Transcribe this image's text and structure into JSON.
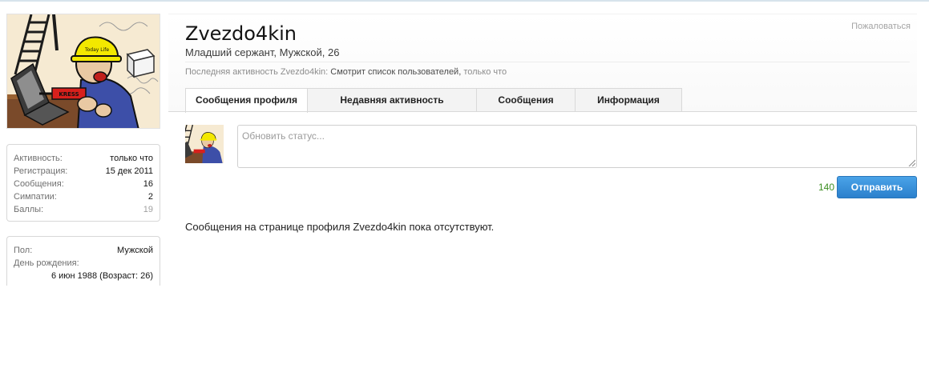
{
  "profile": {
    "username": "Zvezdo4kin",
    "subtitle": "Младший сержант, Мужской, 26",
    "report_label": "Пожаловаться",
    "last_activity": {
      "prefix": "Последняя активность Zvezdo4kin:",
      "action": "Смотрит список пользователей,",
      "time": "только что"
    }
  },
  "tabs": [
    {
      "label": "Сообщения профиля",
      "active": true
    },
    {
      "label": "Недавняя активность",
      "active": false
    },
    {
      "label": "Сообщения",
      "active": false
    },
    {
      "label": "Информация",
      "active": false
    }
  ],
  "status": {
    "placeholder": "Обновить статус...",
    "char_count": "140",
    "submit_label": "Отправить"
  },
  "empty_message": "Сообщения на странице профиля Zvezdo4kin пока отсутствуют.",
  "stats": [
    {
      "label": "Активность:",
      "value": "только что"
    },
    {
      "label": "Регистрация:",
      "value": "15 дек 2011"
    },
    {
      "label": "Сообщения:",
      "value": "16"
    },
    {
      "label": "Симпатии:",
      "value": "2"
    },
    {
      "label": "Баллы:",
      "value": "19"
    }
  ],
  "personal": {
    "gender_label": "Пол:",
    "gender_value": "Мужской",
    "birthday_label": "День рождения:",
    "birthday_value": "6 июн 1988 (Возраст: 26)"
  },
  "avatar_caption": "KRESS",
  "helmet_text": "Today Life",
  "colors": {
    "accent": "#2b80cc",
    "count": "#3d8e23",
    "helmet": "#f3e800"
  }
}
